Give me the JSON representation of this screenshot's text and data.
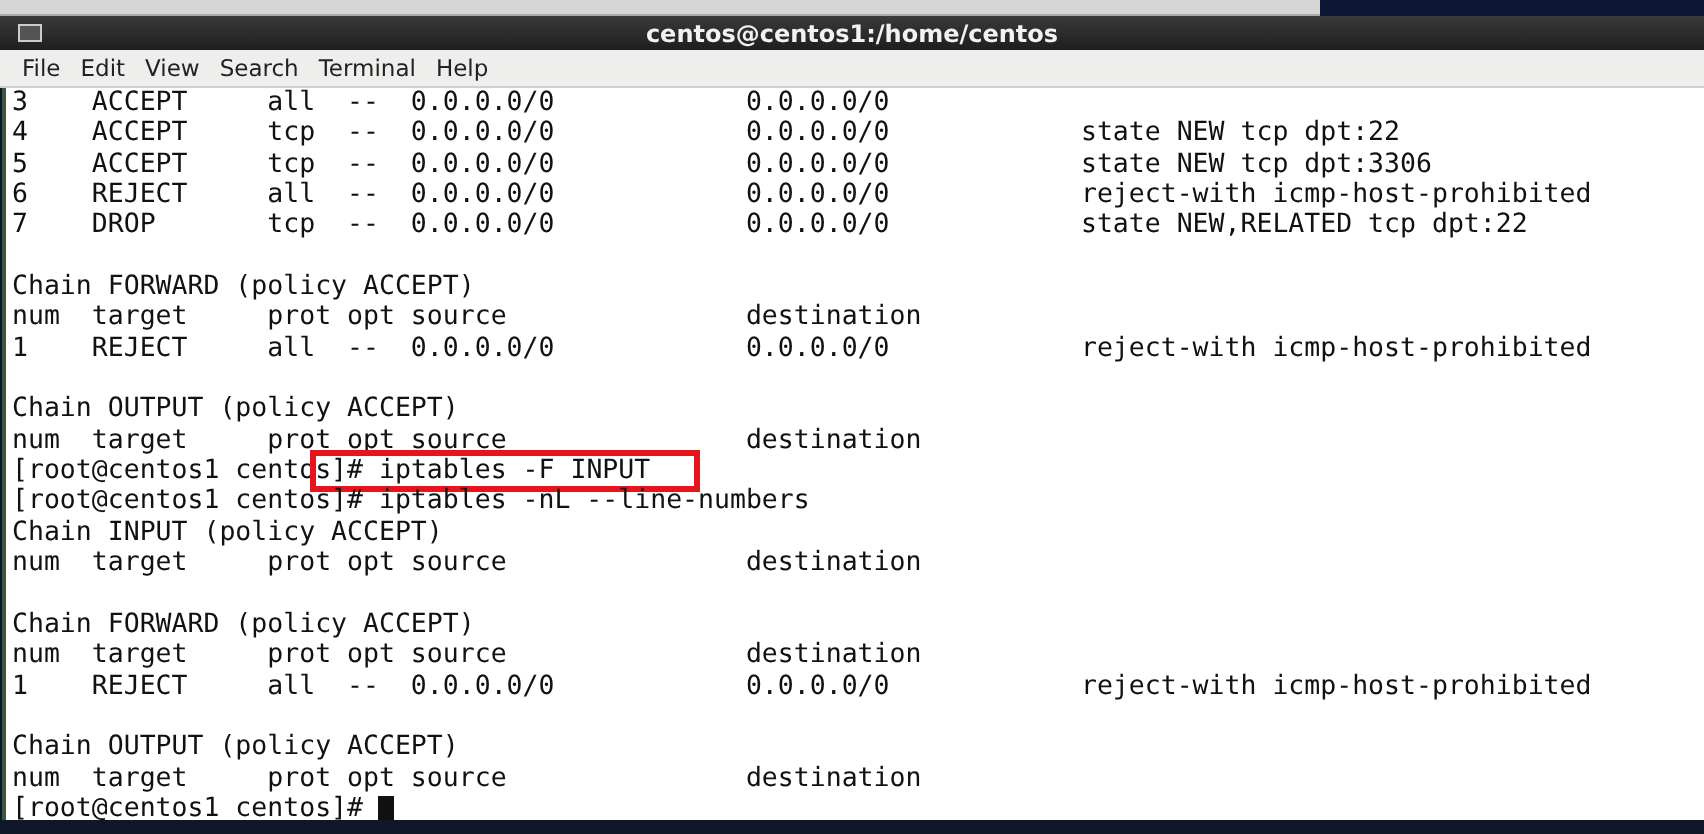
{
  "window": {
    "title": "centos@centos1:/home/centos"
  },
  "menu": [
    "File",
    "Edit",
    "View",
    "Search",
    "Terminal",
    "Help"
  ],
  "terminal": {
    "blocks": [
      {
        "lines": [
          {
            "text": "3    ACCEPT     all  --  0.0.0.0/0            0.0.0.0/0"
          },
          {
            "text": "4    ACCEPT     tcp  --  0.0.0.0/0            0.0.0.0/0            state NEW tcp dpt:22"
          },
          {
            "text": "5    ACCEPT     tcp  --  0.0.0.0/0            0.0.0.0/0            state NEW tcp dpt:3306"
          },
          {
            "text": "6    REJECT     all  --  0.0.0.0/0            0.0.0.0/0            reject-with icmp-host-prohibited"
          },
          {
            "text": "7    DROP       tcp  --  0.0.0.0/0            0.0.0.0/0            state NEW,RELATED tcp dpt:22"
          }
        ]
      },
      {
        "lines": [
          {
            "text": "Chain FORWARD (policy ACCEPT)"
          },
          {
            "text": "num  target     prot opt source               destination"
          },
          {
            "text": "1    REJECT     all  --  0.0.0.0/0            0.0.0.0/0            reject-with icmp-host-prohibited"
          }
        ]
      },
      {
        "lines": [
          {
            "text": "Chain OUTPUT (policy ACCEPT)"
          },
          {
            "text": "num  target     prot opt source               destination"
          },
          {
            "segments": [
              {
                "text": "[root@centos1 cento",
                "highlighted": false
              },
              {
                "text": "s]# iptables -F INPUT",
                "highlighted": true
              }
            ]
          },
          {
            "text": "[root@centos1 centos]# iptables -nL --line-numbers"
          },
          {
            "text": "Chain INPUT (policy ACCEPT)"
          },
          {
            "text": "num  target     prot opt source               destination"
          }
        ]
      },
      {
        "lines": [
          {
            "text": "Chain FORWARD (policy ACCEPT)"
          },
          {
            "text": "num  target     prot opt source               destination"
          },
          {
            "text": "1    REJECT     all  --  0.0.0.0/0            0.0.0.0/0            reject-with icmp-host-prohibited"
          }
        ]
      },
      {
        "lines": [
          {
            "text": "Chain OUTPUT (policy ACCEPT)"
          },
          {
            "text": "num  target     prot opt source               destination"
          },
          {
            "text": "[root@centos1 centos]# ",
            "cursor": true
          }
        ]
      }
    ]
  }
}
